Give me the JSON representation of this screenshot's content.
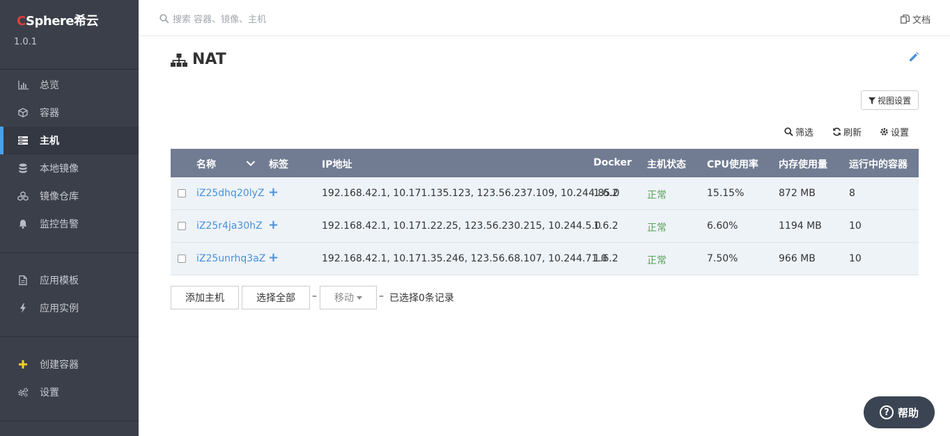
{
  "app": {
    "logo_c": "C",
    "logo_rest": "Sphere希云",
    "version": "1.0.1"
  },
  "sidebar": {
    "items": [
      {
        "label": "总览",
        "icon": "bar-chart-icon"
      },
      {
        "label": "容器",
        "icon": "cube-icon"
      },
      {
        "label": "主机",
        "icon": "server-icon",
        "active": true
      },
      {
        "label": "本地镜像",
        "icon": "database-icon"
      },
      {
        "label": "镜像仓库",
        "icon": "cubes-icon"
      },
      {
        "label": "监控告警",
        "icon": "bell-icon"
      },
      {
        "label": "应用模板",
        "icon": "file-icon"
      },
      {
        "label": "应用实例",
        "icon": "bolt-icon"
      },
      {
        "label": "创建容器",
        "icon": "plus-icon"
      },
      {
        "label": "设置",
        "icon": "gears-icon"
      }
    ]
  },
  "topbar": {
    "search_placeholder": "搜索 容器、镜像、主机",
    "docs_label": "文档"
  },
  "page": {
    "title": "NAT",
    "view_settings_label": "视图设置",
    "filter_label": "筛选",
    "refresh_label": "刷新",
    "settings_label": "设置"
  },
  "table": {
    "headers": {
      "name": "名称",
      "tags": "标签",
      "ip": "IP地址",
      "docker": "Docker",
      "status": "主机状态",
      "cpu": "CPU使用率",
      "memory": "内存使用量",
      "containers": "运行中的容器"
    },
    "rows": [
      {
        "name": "iZ25dhq20lyZ",
        "tag": "+",
        "ip": "192.168.42.1, 10.171.135.123, 123.56.237.109, 10.244.85.0",
        "docker": "1.6.2",
        "status": "正常",
        "cpu": "15.15%",
        "memory": "872 MB",
        "containers": "8"
      },
      {
        "name": "iZ25r4ja30hZ",
        "tag": "+",
        "ip": "192.168.42.1, 10.171.22.25, 123.56.230.215, 10.244.5.0",
        "docker": "1.6.2",
        "status": "正常",
        "cpu": "6.60%",
        "memory": "1194 MB",
        "containers": "10"
      },
      {
        "name": "iZ25unrhq3aZ",
        "tag": "+",
        "ip": "192.168.42.1, 10.171.35.246, 123.56.68.107, 10.244.71.0",
        "docker": "1.6.2",
        "status": "正常",
        "cpu": "7.50%",
        "memory": "966 MB",
        "containers": "10"
      }
    ]
  },
  "actions": {
    "add_host": "添加主机",
    "select_all": "选择全部",
    "dash": "–",
    "move": "移动",
    "selected_text": "已选择0条记录"
  },
  "help": {
    "label": "帮助",
    "icon_glyph": "?"
  },
  "colors": {
    "sidebar_bg": "#3b3f49",
    "active_accent": "#4aa0e6",
    "table_header": "#717c92",
    "row_bg": "#eef3f8",
    "link": "#4a90d9",
    "status_ok": "#5aa05a"
  }
}
